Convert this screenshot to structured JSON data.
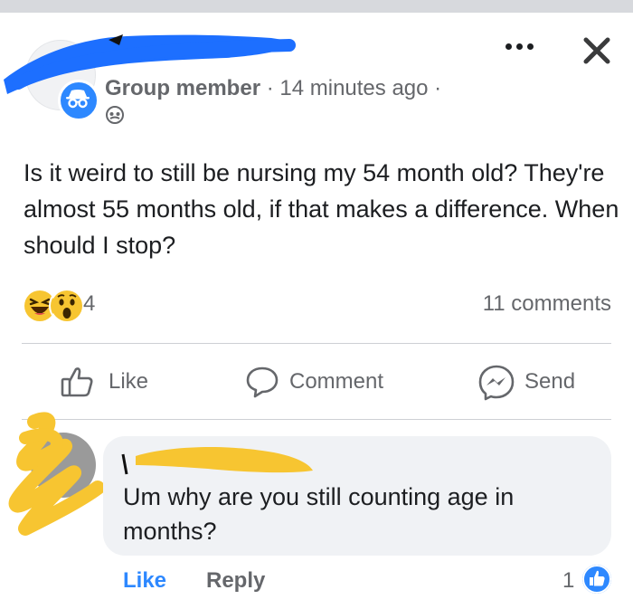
{
  "post": {
    "author_role": "Group member",
    "separator": "·",
    "timestamp": "14 minutes ago",
    "trailing_separator": "·",
    "text": "Is it weird to still be nursing my 54 month old? They're almost 55 months old, if that makes a difference. When should I stop?",
    "reaction_count": "4",
    "reaction_icons": [
      "haha-reaction-icon",
      "wow-reaction-icon"
    ],
    "comments_count": "11 comments"
  },
  "actions": {
    "like": "Like",
    "comment": "Comment",
    "send": "Send"
  },
  "comment": {
    "text": "Um why are you still counting age in months?",
    "like_label": "Like",
    "reply_label": "Reply",
    "like_count": "1"
  },
  "colors": {
    "accent": "#2d88ff",
    "secondary_text": "#65676b",
    "bubble": "#f0f2f5",
    "redaction_blue": "#1d6fff",
    "redaction_yellow": "#f7c531"
  }
}
